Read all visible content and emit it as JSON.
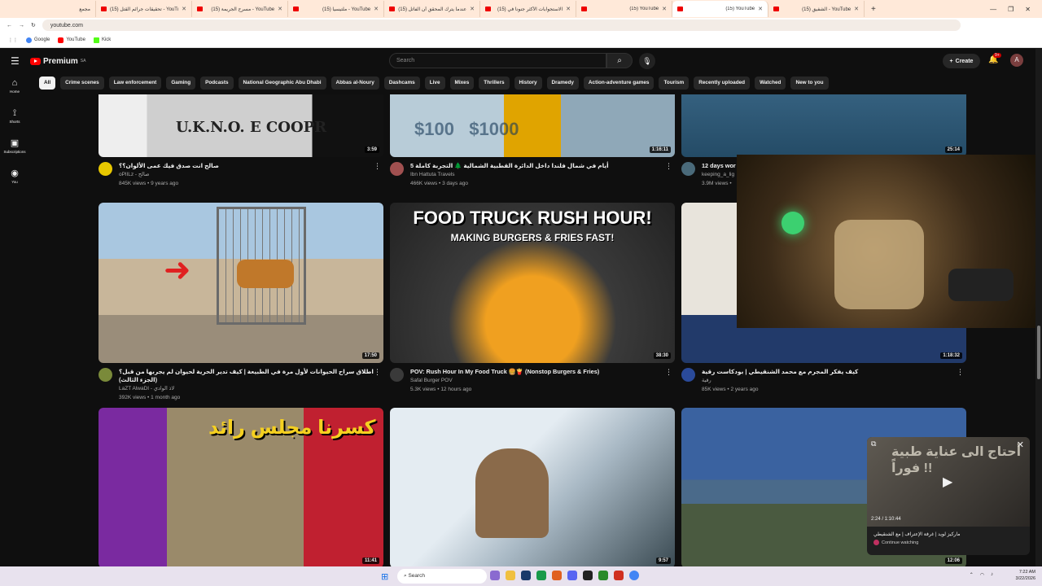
{
  "browser": {
    "tabs": [
      {
        "label": "مجمع"
      },
      {
        "label": "(15) تحقيقات جرائم القتل - YouTube"
      },
      {
        "label": "(15) مسرح الجريمة - YouTube"
      },
      {
        "label": "(15) ملتيسيا - YouTube"
      },
      {
        "label": "(15) عندما يترك المحقق أن الفاتل"
      },
      {
        "label": "(15) الاستجوابات الأكثر جنونا في"
      },
      {
        "label": "(15) YouTube"
      },
      {
        "label": "(15) YouTube"
      },
      {
        "label": "(15) الشفيق - YouTube"
      }
    ],
    "url": "youtube.com",
    "bookmarks": [
      "Google",
      "YouTube",
      "Kick"
    ]
  },
  "header": {
    "brand": "Premium",
    "region": "SA",
    "search_placeholder": "Search",
    "create_label": "Create",
    "notif_badge": "9+",
    "avatar_letter": "A"
  },
  "sidebar": [
    {
      "label": "Home",
      "icon": "home-icon"
    },
    {
      "label": "Shorts",
      "icon": "shorts-icon"
    },
    {
      "label": "Subscriptions",
      "icon": "subscriptions-icon"
    },
    {
      "label": "You",
      "icon": "you-icon"
    }
  ],
  "chips": [
    "All",
    "Crime scenes",
    "Law enforcement",
    "Gaming",
    "Podcasts",
    "National Geographic Abu Dhabi",
    "Abbas al-Noury",
    "Dashcams",
    "Live",
    "Mixes",
    "Thrillers",
    "History",
    "Dramedy",
    "Action-adventure games",
    "Tourism",
    "Recently uploaded",
    "Watched",
    "New to you"
  ],
  "videos": [
    {
      "title": "صالح انت صدق فيك عمى الألوان؟؟",
      "channel": "oPlILz - صالح",
      "stats": "845K views • 9 years ago",
      "duration": "3:59",
      "thumb_text": "U.K.N.O. E COOPR",
      "colors": [
        "#dcdcdc",
        "#1a1a1a"
      ]
    },
    {
      "title": "5 أيام في شمال فلندا داخل الدائرة القطبية الشمالية 🌲 التجربة كاملة",
      "channel": "Ibn Hattuta Travels",
      "stats": "466K views • 3 days ago",
      "duration": "1:16:11",
      "thumb_text": "$100   $1000",
      "colors": [
        "#9fb8c8",
        "#e0a000"
      ]
    },
    {
      "title": "12 days wor",
      "channel": "keeping_a_lig",
      "stats": "3.9M views •",
      "duration": "25:14",
      "thumb_text": "",
      "colors": [
        "#3d6f8f",
        "#26506b"
      ]
    },
    {
      "title": "اطلاق سراح الحيوانات لأول مرة في الطبيعة | كيف تدير الحرية لحيوان لم يجربها من قبل؟ (الجزء الثالث)",
      "channel": "LaZT AlwaDI - لاذ الوادي",
      "stats": "392K views • 1 month ago",
      "duration": "17:50",
      "thumb_text": "",
      "colors": [
        "#c8b69a",
        "#8a9aa8"
      ]
    },
    {
      "title": "POV: Rush Hour In My Food Truck 🍔🍟 (Nonstop Burgers & Fries)",
      "channel": "Safal Burger POV",
      "stats": "5.3K views • 12 hours ago",
      "duration": "38:30",
      "thumb_text": "FOOD TRUCK RUSH HOUR!",
      "thumb_sub": "MAKING BURGERS & FRIES FAST!",
      "colors": [
        "#3a3a3a",
        "#f0b020"
      ]
    },
    {
      "title": "كيف يفكر المجرم مع محمد الشنقيطي | بودكاست رقية",
      "channel": "رقية",
      "stats": "85K views • 2 years ago",
      "duration": "1:18:32",
      "thumb_text": "",
      "colors": [
        "#e8e4dc",
        "#223a6a"
      ]
    },
    {
      "title": "",
      "channel": "",
      "stats": "",
      "duration": "11:41",
      "thumb_text": "كسرنا مجلس رائد",
      "colors": [
        "#c02030",
        "#80b040"
      ]
    },
    {
      "title": "",
      "channel": "",
      "stats": "",
      "duration": "9:57",
      "thumb_text": "",
      "colors": [
        "#d8e4ee",
        "#3a4a52"
      ]
    },
    {
      "title": "",
      "channel": "",
      "stats": "",
      "duration": "12:06",
      "thumb_text": "",
      "colors": [
        "#6a90b8",
        "#3a4a3a"
      ]
    }
  ],
  "miniplayer": {
    "overlay_text": "أحتاج الى عناية طبية فوراً !!",
    "time": "2:24 / 1:10:44",
    "title": "ماركيز لويد | غرفة الإعتراف | مع الشنقيطي",
    "continue": "Continue watching"
  },
  "taskbar": {
    "search": "Search",
    "time": "7:22 AM",
    "date": "3/22/2026"
  }
}
